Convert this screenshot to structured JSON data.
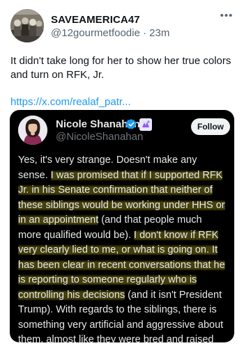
{
  "post": {
    "author_name": "SAVEAMERICA47",
    "author_handle": "@12gourmetfoodie",
    "separator": " · ",
    "time_ago": "23m",
    "more_icon": "more-horizontal-icon",
    "text": "It didn't take long for her to show her true colors and turn on RFK, Jr.",
    "link": "https://x.com/realaf_patr..."
  },
  "quoted_post": {
    "author_name": "Nicole Shanahan",
    "author_handle": "@NicoleShanahan",
    "verified_icon": "verified-badge-icon",
    "affiliate_icon": "affiliate-badge-icon",
    "follow_label": "Follow",
    "accent_color": "#1d9bf0",
    "highlight_color": "#7e7816",
    "segments": [
      {
        "text": "Yes, it's very strange. Doesn't make any sense. ",
        "highlight": false
      },
      {
        "text": "I was promised that if I supported RFK Jr. in his Senate confirmation that neither of these siblings would be working under HHS or in an appointment",
        "highlight": true
      },
      {
        "text": " (and that people much more qualified would be). ",
        "highlight": false
      },
      {
        "text": "I don't know if RFK very clearly lied to me, or what is going on. It has been clear in recent conversations that he is reporting to someone regularly who is controlling his decisions",
        "highlight": true
      },
      {
        "text": " (and it isn't President Trump). With regards to the siblings, there is something very artificial and aggressive about them, almost like they were bred and raised Manchurian assets.",
        "highlight": false
      }
    ]
  }
}
